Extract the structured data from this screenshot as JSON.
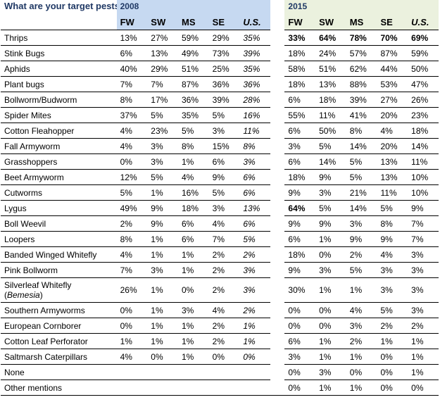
{
  "question": "What are your target pests?",
  "years": [
    "2008",
    "2015"
  ],
  "columns_2008": [
    "FW",
    "SW",
    "MS",
    "SE",
    "U.S."
  ],
  "columns_2015": [
    "FW",
    "SW",
    "MS",
    "SE",
    "U.S."
  ],
  "rows": [
    {
      "label": "Thrips",
      "v2008": [
        "13%",
        "27%",
        "59%",
        "29%",
        "35%"
      ],
      "v2015": [
        "33%",
        "64%",
        "78%",
        "70%",
        "69%"
      ],
      "bold2015": true
    },
    {
      "label": "Stink Bugs",
      "v2008": [
        "6%",
        "13%",
        "49%",
        "73%",
        "39%"
      ],
      "v2015": [
        "18%",
        "24%",
        "57%",
        "87%",
        "59%"
      ]
    },
    {
      "label": "Aphids",
      "v2008": [
        "40%",
        "29%",
        "51%",
        "25%",
        "35%"
      ],
      "v2015": [
        "58%",
        "51%",
        "62%",
        "44%",
        "50%"
      ]
    },
    {
      "label": "Plant bugs",
      "v2008": [
        "7%",
        "7%",
        "87%",
        "36%",
        "36%"
      ],
      "v2015": [
        "18%",
        "13%",
        "88%",
        "53%",
        "47%"
      ]
    },
    {
      "label": "Bollworm/Budworm",
      "v2008": [
        "8%",
        "17%",
        "36%",
        "39%",
        "28%"
      ],
      "v2015": [
        "6%",
        "18%",
        "39%",
        "27%",
        "26%"
      ]
    },
    {
      "label": "Spider Mites",
      "v2008": [
        "37%",
        "5%",
        "35%",
        "5%",
        "16%"
      ],
      "v2015": [
        "55%",
        "11%",
        "41%",
        "20%",
        "23%"
      ]
    },
    {
      "label": "Cotton Fleahopper",
      "v2008": [
        "4%",
        "23%",
        "5%",
        "3%",
        "11%"
      ],
      "v2015": [
        "6%",
        "50%",
        "8%",
        "4%",
        "18%"
      ]
    },
    {
      "label": "Fall Armyworm",
      "v2008": [
        "4%",
        "3%",
        "8%",
        "15%",
        "8%"
      ],
      "v2015": [
        "3%",
        "5%",
        "14%",
        "20%",
        "14%"
      ]
    },
    {
      "label": "Grasshoppers",
      "v2008": [
        "0%",
        "3%",
        "1%",
        "6%",
        "3%"
      ],
      "v2015": [
        "6%",
        "14%",
        "5%",
        "13%",
        "11%"
      ]
    },
    {
      "label": "Beet Armyworm",
      "v2008": [
        "12%",
        "5%",
        "4%",
        "9%",
        "6%"
      ],
      "v2015": [
        "18%",
        "9%",
        "5%",
        "13%",
        "10%"
      ]
    },
    {
      "label": "Cutworms",
      "v2008": [
        "5%",
        "1%",
        "16%",
        "5%",
        "6%"
      ],
      "v2015": [
        "9%",
        "3%",
        "21%",
        "11%",
        "10%"
      ]
    },
    {
      "label": "Lygus",
      "v2008": [
        "49%",
        "9%",
        "18%",
        "3%",
        "13%"
      ],
      "v2015": [
        "64%",
        "5%",
        "14%",
        "5%",
        "9%"
      ],
      "boldFirst2015": true
    },
    {
      "label": "Boll Weevil",
      "v2008": [
        "2%",
        "9%",
        "6%",
        "4%",
        "6%"
      ],
      "v2015": [
        "9%",
        "9%",
        "3%",
        "8%",
        "7%"
      ]
    },
    {
      "label": "Loopers",
      "v2008": [
        "8%",
        "1%",
        "6%",
        "7%",
        "5%"
      ],
      "v2015": [
        "6%",
        "1%",
        "9%",
        "9%",
        "7%"
      ]
    },
    {
      "label": "Banded Winged Whitefly",
      "v2008": [
        "4%",
        "1%",
        "1%",
        "2%",
        "2%"
      ],
      "v2015": [
        "18%",
        "0%",
        "2%",
        "4%",
        "3%"
      ]
    },
    {
      "label": "Pink Bollworm",
      "v2008": [
        "7%",
        "3%",
        "1%",
        "2%",
        "3%"
      ],
      "v2015": [
        "9%",
        "3%",
        "5%",
        "3%",
        "3%"
      ]
    },
    {
      "label": "Silverleaf Whitefly",
      "label_sub": "Bemesia",
      "v2008": [
        "26%",
        "1%",
        "0%",
        "2%",
        "3%"
      ],
      "v2015": [
        "30%",
        "1%",
        "1%",
        "3%",
        "3%"
      ]
    },
    {
      "label": "Southern Armyworms",
      "v2008": [
        "0%",
        "1%",
        "3%",
        "4%",
        "2%"
      ],
      "v2015": [
        "0%",
        "0%",
        "4%",
        "5%",
        "3%"
      ]
    },
    {
      "label": "European Cornborer",
      "v2008": [
        "0%",
        "1%",
        "1%",
        "2%",
        "1%"
      ],
      "v2015": [
        "0%",
        "0%",
        "3%",
        "2%",
        "2%"
      ]
    },
    {
      "label": "Cotton Leaf Perforator",
      "v2008": [
        "1%",
        "1%",
        "1%",
        "2%",
        "1%"
      ],
      "v2015": [
        "6%",
        "1%",
        "2%",
        "1%",
        "1%"
      ]
    },
    {
      "label": "Saltmarsh Caterpillars",
      "v2008": [
        "4%",
        "0%",
        "1%",
        "0%",
        "0%"
      ],
      "v2015": [
        "3%",
        "1%",
        "1%",
        "0%",
        "1%"
      ]
    },
    {
      "label": "None",
      "v2008": [
        "",
        "",
        "",
        "",
        ""
      ],
      "v2015": [
        "0%",
        "3%",
        "0%",
        "0%",
        "1%"
      ]
    },
    {
      "label": "Other mentions",
      "v2008": [
        "",
        "",
        "",
        "",
        ""
      ],
      "v2015": [
        "0%",
        "1%",
        "1%",
        "0%",
        "0%"
      ]
    }
  ],
  "colors": {
    "header_2008": "#c6d9f1",
    "header_2015": "#ebf1de",
    "year_text": "#1f3864"
  }
}
